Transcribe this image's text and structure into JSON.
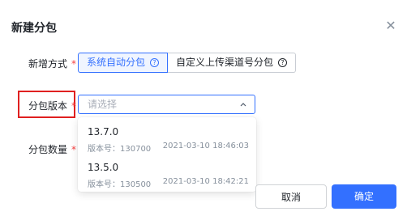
{
  "dialog": {
    "title": "新建分包",
    "close_icon": "close-icon"
  },
  "form": {
    "mode_label": "新增方式",
    "mode_required": "*",
    "mode_options": [
      {
        "label": "系统自动分包",
        "icon": "question-circle-icon",
        "selected": true
      },
      {
        "label": "自定义上传渠道号分包",
        "icon": "question-circle-icon",
        "selected": false
      }
    ],
    "version_label": "分包版本",
    "version_required": "*",
    "version_placeholder": "请选择",
    "count_label": "分包数量",
    "count_required": "*"
  },
  "dropdown": {
    "options": [
      {
        "version": "13.7.0",
        "code": "版本号：130700",
        "time": "2021-03-10 18:46:03"
      },
      {
        "version": "13.5.0",
        "code": "版本号：130500",
        "time": "2021-03-10 18:42:21"
      }
    ]
  },
  "buttons": {
    "cancel": "取消",
    "confirm": "确定"
  },
  "colors": {
    "accent": "#3370ff",
    "required": "#f53f3f",
    "highlight": "#e02020"
  }
}
